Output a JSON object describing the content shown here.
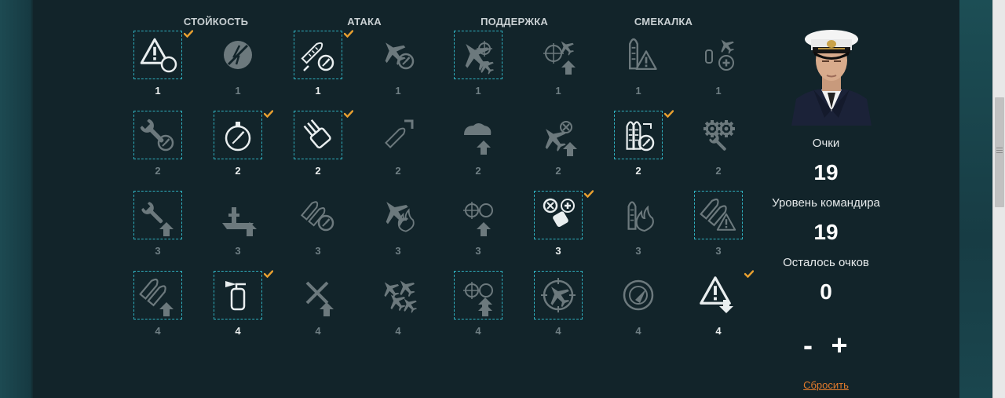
{
  "columns": [
    "СТОЙКОСТЬ",
    "АТАКА",
    "ПОДДЕРЖКА",
    "СМЕКАЛКА"
  ],
  "skills": [
    {
      "cost": "1",
      "selected": true,
      "learned": true,
      "icon": "warning-timer-icon"
    },
    {
      "cost": "1",
      "selected": false,
      "learned": false,
      "icon": "no-lightning-icon"
    },
    {
      "cost": "1",
      "selected": true,
      "learned": true,
      "icon": "torpedo-timer-icon"
    },
    {
      "cost": "1",
      "selected": false,
      "learned": false,
      "icon": "plane-timer-icon"
    },
    {
      "cost": "1",
      "selected": true,
      "learned": false,
      "icon": "plane-crosshair-icon"
    },
    {
      "cost": "1",
      "selected": false,
      "learned": false,
      "icon": "plane-target-upgrade-icon"
    },
    {
      "cost": "1",
      "selected": false,
      "learned": false,
      "icon": "torpedo-warning-icon"
    },
    {
      "cost": "1",
      "selected": false,
      "learned": false,
      "icon": "bomb-plane-repair-icon"
    },
    {
      "cost": "2",
      "selected": true,
      "learned": false,
      "icon": "wrench-timer-icon"
    },
    {
      "cost": "2",
      "selected": true,
      "learned": true,
      "icon": "stopwatch-icon"
    },
    {
      "cost": "2",
      "selected": true,
      "learned": true,
      "icon": "turret-icon"
    },
    {
      "cost": "2",
      "selected": false,
      "learned": false,
      "icon": "shell-upgrade-icon"
    },
    {
      "cost": "2",
      "selected": false,
      "learned": false,
      "icon": "smoke-upgrade-icon"
    },
    {
      "cost": "2",
      "selected": false,
      "learned": false,
      "icon": "plane-no-upgrade-icon"
    },
    {
      "cost": "2",
      "selected": true,
      "learned": true,
      "icon": "torpedoes-timer-icon"
    },
    {
      "cost": "2",
      "selected": false,
      "learned": false,
      "icon": "gears-wrench-icon"
    },
    {
      "cost": "3",
      "selected": true,
      "learned": false,
      "icon": "wrench-upgrade-icon"
    },
    {
      "cost": "3",
      "selected": false,
      "learned": false,
      "icon": "ship-upgrade-icon"
    },
    {
      "cost": "3",
      "selected": false,
      "learned": false,
      "icon": "shells-timer-icon"
    },
    {
      "cost": "3",
      "selected": false,
      "learned": false,
      "icon": "plane-fire-icon"
    },
    {
      "cost": "3",
      "selected": false,
      "learned": false,
      "icon": "targets-upgrade-icon"
    },
    {
      "cost": "3",
      "selected": true,
      "learned": true,
      "icon": "plane-repair-tank-icon"
    },
    {
      "cost": "3",
      "selected": false,
      "learned": false,
      "icon": "torpedo-fire-icon"
    },
    {
      "cost": "3",
      "selected": true,
      "learned": false,
      "icon": "shells-warning-icon"
    },
    {
      "cost": "4",
      "selected": true,
      "learned": false,
      "icon": "shells-upgrade-icon"
    },
    {
      "cost": "4",
      "selected": true,
      "learned": true,
      "icon": "extinguisher-icon"
    },
    {
      "cost": "4",
      "selected": false,
      "learned": false,
      "icon": "crossed-tools-upgrade-icon"
    },
    {
      "cost": "4",
      "selected": false,
      "learned": false,
      "icon": "planes-formation-icon"
    },
    {
      "cost": "4",
      "selected": true,
      "learned": false,
      "icon": "targets-double-upgrade-icon"
    },
    {
      "cost": "4",
      "selected": true,
      "learned": false,
      "icon": "plane-crosshair-circle-icon"
    },
    {
      "cost": "4",
      "selected": false,
      "learned": false,
      "icon": "radar-icon"
    },
    {
      "cost": "4",
      "selected": false,
      "learned": true,
      "icon": "warning-down-icon"
    }
  ],
  "side": {
    "points_label": "Очки",
    "points_value": "19",
    "level_label": "Уровень командира",
    "level_value": "19",
    "remaining_label": "Осталось очков",
    "remaining_value": "0",
    "minus": "-",
    "plus": "+",
    "reset": "Сбросить"
  },
  "colors": {
    "accent_check": "#e8a030",
    "selected_border": "#2fb0bf",
    "reset_link": "#e07a2c"
  }
}
